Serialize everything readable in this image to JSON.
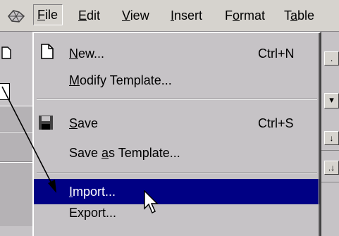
{
  "menubar": {
    "items": [
      "File",
      "Edit",
      "View",
      "Insert",
      "Format",
      "Table"
    ]
  },
  "file_menu": {
    "new": {
      "label": "New...",
      "shortcut": "Ctrl+N"
    },
    "modify_template": {
      "label": "Modify Template..."
    },
    "save": {
      "label": "Save",
      "shortcut": "Ctrl+S"
    },
    "save_as_template": {
      "label": "Save as Template..."
    },
    "import": {
      "label": "Import..."
    },
    "export": {
      "label": "Export..."
    },
    "selected": "Import..."
  },
  "colors": {
    "selection": "#000084",
    "menu_face": "#c6c3c6"
  },
  "icons": [
    "app-icon",
    "new-document-icon",
    "save-disk-icon",
    "mouse-pointer-icon",
    "annotation-arrow"
  ]
}
